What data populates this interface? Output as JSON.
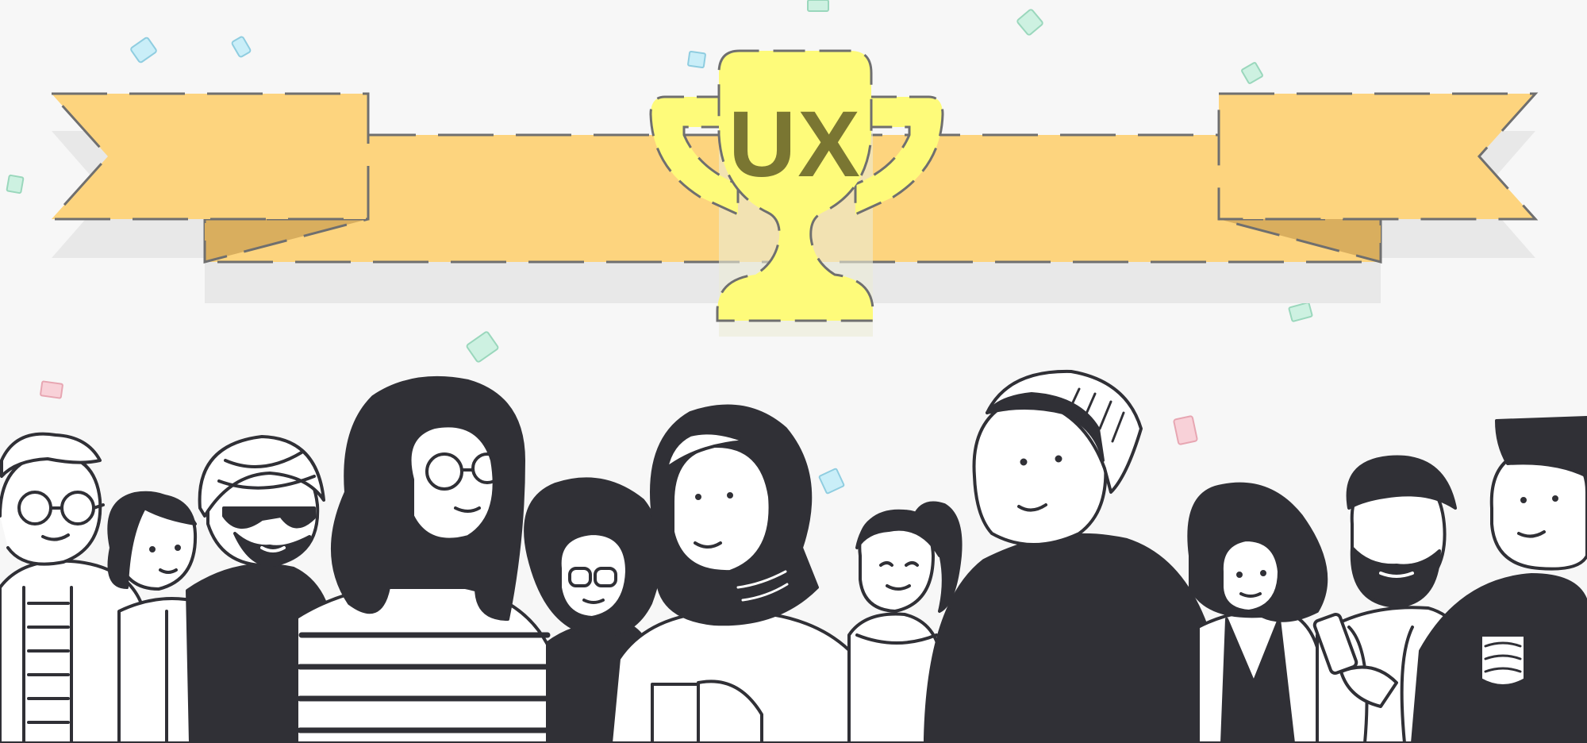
{
  "trophy": {
    "label": "UX"
  },
  "colors": {
    "background": "#f7f7f7",
    "banner": "#fdd47e",
    "banner_fold": "#d9ae5e",
    "trophy_gold": "#fefb7a",
    "trophy_text": "#7a7632",
    "ink": "#303036",
    "shadow": "#e8e8e8",
    "dash": "#6f6f6f"
  },
  "icons": {
    "trophy": "trophy-icon",
    "banner": "ribbon-banner-icon",
    "confetti": "confetti-icon",
    "people": "people-group-icon"
  }
}
